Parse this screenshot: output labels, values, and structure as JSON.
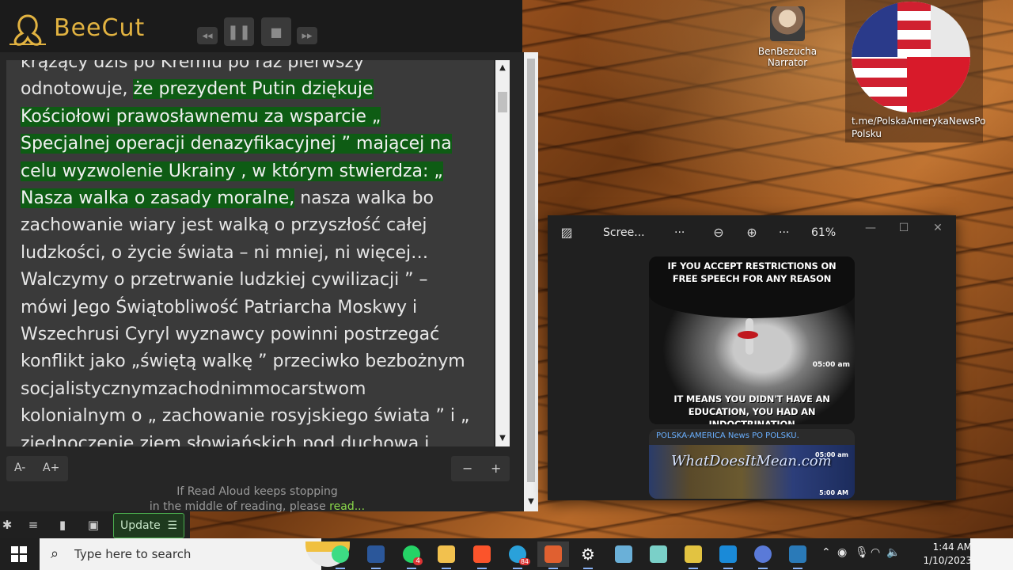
{
  "beecut": {
    "brand": "BeeCut",
    "controls": [
      "rewind",
      "pause",
      "stop",
      "fast-forward"
    ]
  },
  "reader": {
    "lines": [
      {
        "pre": "krążący dziś po Kremlu po raz pierwszy",
        "hl": "",
        "post": ""
      },
      {
        "pre": "odnotowuje, ",
        "hl": "że prezydent Putin dziękuje",
        "post": ""
      },
      {
        "pre": "",
        "hl": "Kościołowi prawosławnemu za wsparcie „",
        "post": ""
      },
      {
        "pre": "",
        "hl": "Specjalnej operacji denazyfikacyjnej ” mającej na",
        "post": ""
      },
      {
        "pre": "",
        "hl": "celu wyzwolenie Ukrainy , w którym stwierdza: „",
        "post": ""
      },
      {
        "pre": "",
        "hl": "Nasza walka o zasady moralne,",
        "post": " nasza walka bo"
      },
      {
        "pre": "zachowanie wiary jest walką o przyszłość całej",
        "hl": "",
        "post": ""
      },
      {
        "pre": "ludzkości, o życie świata – ni mniej, ni więcej…",
        "hl": "",
        "post": ""
      },
      {
        "pre": "Walczymy o przetrwanie ludzkiej cywilizacji ” –",
        "hl": "",
        "post": ""
      },
      {
        "pre": "mówi Jego Świątobliwość Patriarcha Moskwy i",
        "hl": "",
        "post": ""
      },
      {
        "pre": "Wszechrusi Cyryl wyznawcy powinni postrzegać",
        "hl": "",
        "post": ""
      },
      {
        "pre": "konflikt jako „świętą walkę ” przeciwko bezbożnym",
        "hl": "",
        "post": ""
      },
      {
        "pre": "socjalistycznymzachodnimmocarstwom",
        "hl": "",
        "post": ""
      },
      {
        "pre": "kolonialnym o „ zachowanie rosyjskiego świata ” i „",
        "hl": "",
        "post": ""
      },
      {
        "pre": "zjednoczenie ziem słowiańskich pod duchową i",
        "hl": "",
        "post": ""
      }
    ],
    "font_minus": "A-",
    "font_plus": "A+",
    "zoom_minus": "−",
    "zoom_plus": "+",
    "hint_line1": "If Read Aloud keeps stopping",
    "hint_line2": "in the middle of reading, please ",
    "hint_link": "read..."
  },
  "readerbar": {
    "update_label": "Update",
    "update_icon": "☰"
  },
  "desktop": {
    "icon1_label_line1": "BenBezucha",
    "icon1_label_line2": "Narrator",
    "icon2_label_line1": "t.me/PolskaAmerykaNewsPo",
    "icon2_label_line2": "Polsku"
  },
  "photos": {
    "title": "Scree...",
    "more1": "···",
    "more2": "···",
    "zoom_level": "61%",
    "image1_top": "IF YOU ACCEPT RESTRICTIONS ON FREE SPEECH FOR ANY REASON",
    "image1_bottom": "IT MEANS YOU DIDN'T HAVE AN EDUCATION, YOU HAD AN INDOCTRINATION",
    "image1_time": "05:00 am",
    "card2_title": "POLSKA-AMERICA News PO POLSKU.",
    "card2_watermark": "WhatDoesItMean.com",
    "card2_time": "05:00 am",
    "card2_time2": "5:00 AM"
  },
  "taskbar": {
    "search_placeholder": "Type here to search",
    "time": "1:44 AM",
    "date": "1/10/2023",
    "whatsapp_badge": "4",
    "telegram_badge": "84"
  }
}
